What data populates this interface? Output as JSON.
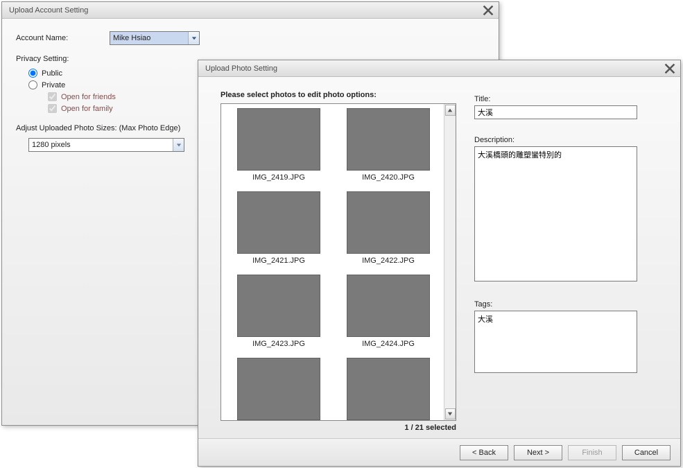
{
  "account_dialog": {
    "title": "Upload Account Setting",
    "account_name_label": "Account Name:",
    "account_name_value": "Mike Hsiao",
    "privacy_heading": "Privacy Setting:",
    "radio_public": "Public",
    "radio_private": "Private",
    "check_friends": "Open for friends",
    "check_family": "Open for family",
    "size_heading": "Adjust Uploaded Photo Sizes: (Max Photo Edge)",
    "size_value": "1280 pixels"
  },
  "photo_dialog": {
    "title": "Upload Photo Setting",
    "instruction": "Please select photos to edit photo options:",
    "selected_count": "1 / 21 selected",
    "thumbs": [
      {
        "name": "IMG_2419.JPG"
      },
      {
        "name": "IMG_2420.JPG"
      },
      {
        "name": "IMG_2421.JPG"
      },
      {
        "name": "IMG_2422.JPG"
      },
      {
        "name": "IMG_2423.JPG"
      },
      {
        "name": "IMG_2424.JPG"
      }
    ],
    "title_label": "Title:",
    "title_value": "大溪",
    "desc_label": "Description:",
    "desc_value": "大溪橋頭的雕塑蠻特別的",
    "tags_label": "Tags:",
    "tags_value": "大溪",
    "btn_back": "< Back",
    "btn_next": "Next >",
    "btn_finish": "Finish",
    "btn_cancel": "Cancel"
  }
}
